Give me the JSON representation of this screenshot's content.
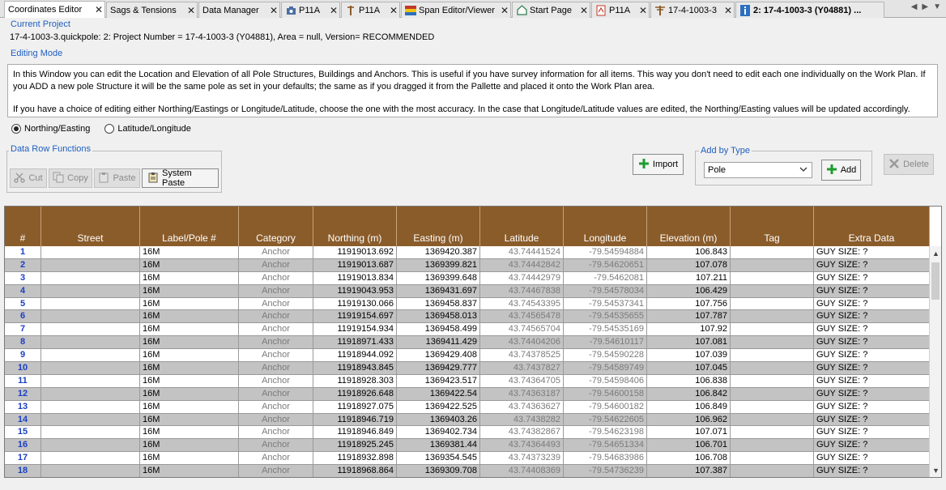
{
  "tabs": [
    {
      "label": "Coordinates Editor",
      "icon": "none",
      "active": true
    },
    {
      "label": "Sags & Tensions",
      "icon": "none"
    },
    {
      "label": "Data Manager",
      "icon": "none"
    },
    {
      "label": "P11A",
      "icon": "camera-icon"
    },
    {
      "label": "P11A",
      "icon": "pole-icon"
    },
    {
      "label": "Span Editor/Viewer",
      "icon": "span-icon"
    },
    {
      "label": "Start Page",
      "icon": "home-icon"
    },
    {
      "label": "P11A",
      "icon": "pdf-icon"
    },
    {
      "label": "17-4-1003-3",
      "icon": "structure-icon"
    },
    {
      "label": "2: 17-4-1003-3 (Y04881) ...",
      "icon": "info-icon"
    }
  ],
  "current_project": {
    "label": "Current Project",
    "text": "17-4-1003-3.quickpole: 2: Project Number = 17-4-1003-3 (Y04881), Area = null, Version= RECOMMENDED"
  },
  "editing_mode": {
    "label": "Editing Mode",
    "paragraph1": "In this Window you can edit the Location and Elevation of all Pole Structures, Buildings and Anchors. This is useful if you have survey information for all items. This way you don't need to edit each one individually on the Work Plan. If you ADD a new pole Structure it will be the same pole as set in your defaults; the same as if you dragged it from the Pallette and placed it onto the Work Plan area.",
    "paragraph2": "If you have a choice of editing either Northing/Eastings or Longitude/Latitude, choose the one with the most accuracy. In the case that Longitude/Latitude values are edited, the Northing/Easting values will be updated accordingly.",
    "radio_northing": "Northing/Easting",
    "radio_latlon": "Latitude/Longitude"
  },
  "data_row_functions": {
    "label": "Data Row Functions",
    "cut": "Cut",
    "copy": "Copy",
    "paste": "Paste",
    "system_paste": "System Paste"
  },
  "toolbar": {
    "import": "Import",
    "add_by_type_label": "Add by Type",
    "add_type_value": "Pole",
    "add": "Add",
    "delete": "Delete"
  },
  "table": {
    "headers": [
      "#",
      "Street",
      "Label/Pole #",
      "Category",
      "Northing (m)",
      "Easting (m)",
      "Latitude",
      "Longitude",
      "Elevation (m)",
      "Tag",
      "Extra Data"
    ],
    "rows": [
      [
        "1",
        "",
        "16M",
        "Anchor",
        "11919013.692",
        "1369420.387",
        "43.74441524",
        "-79.54594884",
        "106.843",
        "",
        "GUY SIZE:      ?"
      ],
      [
        "2",
        "",
        "16M",
        "Anchor",
        "11919013.687",
        "1369399.821",
        "43.74442842",
        "-79.54620651",
        "107.078",
        "",
        "GUY SIZE:      ?"
      ],
      [
        "3",
        "",
        "16M",
        "Anchor",
        "11919013.834",
        "1369399.648",
        "43.74442979",
        "-79.5462081",
        "107.211",
        "",
        "GUY SIZE:      ?"
      ],
      [
        "4",
        "",
        "16M",
        "Anchor",
        "11919043.953",
        "1369431.697",
        "43.74467838",
        "-79.54578034",
        "106.429",
        "",
        "GUY SIZE:      ?"
      ],
      [
        "5",
        "",
        "16M",
        "Anchor",
        "11919130.066",
        "1369458.837",
        "43.74543395",
        "-79.54537341",
        "107.756",
        "",
        "GUY SIZE:      ?"
      ],
      [
        "6",
        "",
        "16M",
        "Anchor",
        "11919154.697",
        "1369458.013",
        "43.74565478",
        "-79.54535655",
        "107.787",
        "",
        "GUY SIZE:      ?"
      ],
      [
        "7",
        "",
        "16M",
        "Anchor",
        "11919154.934",
        "1369458.499",
        "43.74565704",
        "-79.54535169",
        "107.92",
        "",
        "GUY SIZE:      ?"
      ],
      [
        "8",
        "",
        "16M",
        "Anchor",
        "11918971.433",
        "1369411.429",
        "43.74404206",
        "-79.54610117",
        "107.081",
        "",
        "GUY SIZE:      ?"
      ],
      [
        "9",
        "",
        "16M",
        "Anchor",
        "11918944.092",
        "1369429.408",
        "43.74378525",
        "-79.54590228",
        "107.039",
        "",
        "GUY SIZE:      ?"
      ],
      [
        "10",
        "",
        "16M",
        "Anchor",
        "11918943.845",
        "1369429.777",
        "43.7437827",
        "-79.54589749",
        "107.045",
        "",
        "GUY SIZE:      ?"
      ],
      [
        "11",
        "",
        "16M",
        "Anchor",
        "11918928.303",
        "1369423.517",
        "43.74364705",
        "-79.54598406",
        "106.838",
        "",
        "GUY SIZE:      ?"
      ],
      [
        "12",
        "",
        "16M",
        "Anchor",
        "11918926.648",
        "1369422.54",
        "43.74363187",
        "-79.54600158",
        "106.842",
        "",
        "GUY SIZE:      ?"
      ],
      [
        "13",
        "",
        "16M",
        "Anchor",
        "11918927.075",
        "1369422.525",
        "43.74363627",
        "-79.54600182",
        "106.849",
        "",
        "GUY SIZE:      ?"
      ],
      [
        "14",
        "",
        "16M",
        "Anchor",
        "11918946.719",
        "1369403.26",
        "43.7438282",
        "-79.54622605",
        "106.962",
        "",
        "GUY SIZE:      ?"
      ],
      [
        "15",
        "",
        "16M",
        "Anchor",
        "11918946.849",
        "1369402.734",
        "43.74382867",
        "-79.54623198",
        "107.071",
        "",
        "GUY SIZE:      ?"
      ],
      [
        "16",
        "",
        "16M",
        "Anchor",
        "11918925.245",
        "1369381.44",
        "43.74364493",
        "-79.54651334",
        "106.701",
        "",
        "GUY SIZE:      ?"
      ],
      [
        "17",
        "",
        "16M",
        "Anchor",
        "11918932.898",
        "1369354.545",
        "43.74373239",
        "-79.54683986",
        "106.708",
        "",
        "GUY SIZE:      ?"
      ],
      [
        "18",
        "",
        "16M",
        "Anchor",
        "11918968.864",
        "1369309.708",
        "43.74408369",
        "-79.54736239",
        "107.387",
        "",
        "GUY SIZE:      ?"
      ]
    ]
  },
  "colors": {
    "header_bg": "#8a5c2a",
    "row_alt": "#c3c3c3",
    "row_number": "#1a3fc4",
    "section_label": "#1f5fbf"
  }
}
